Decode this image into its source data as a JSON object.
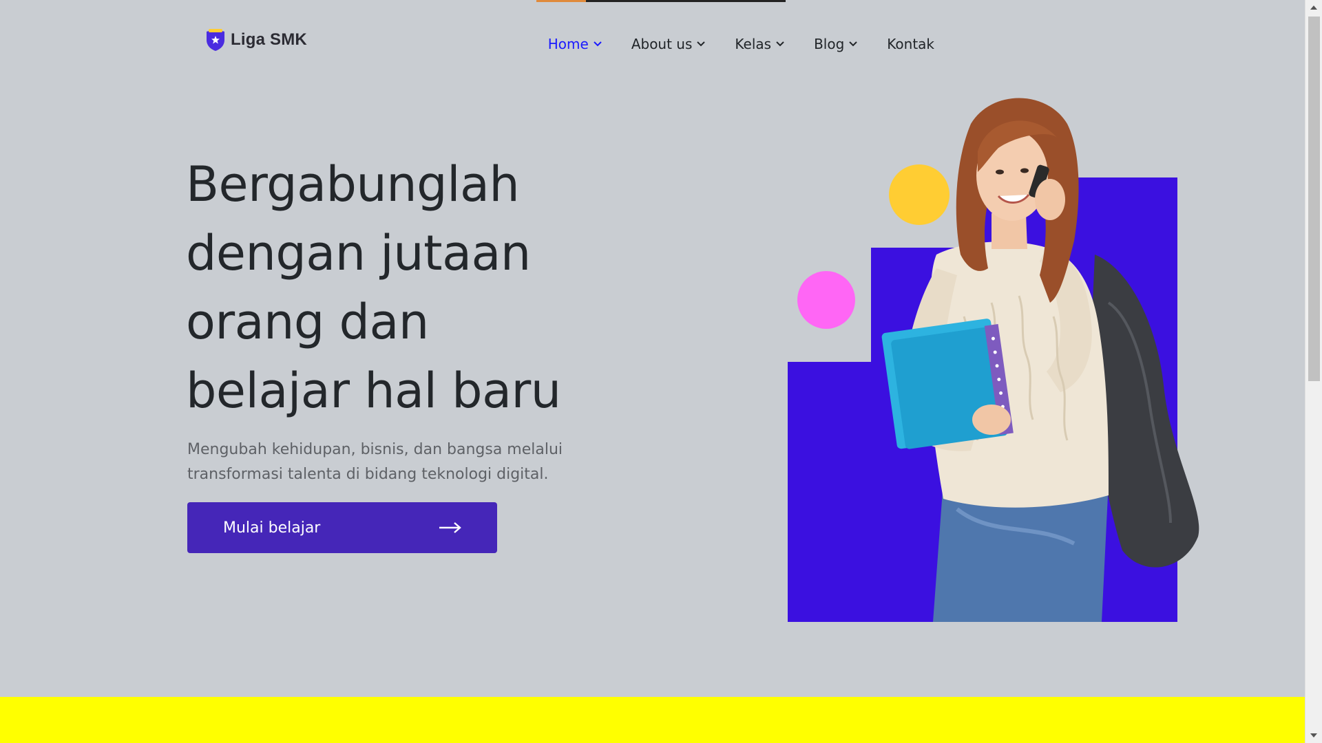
{
  "brand": {
    "name": "Liga SMK",
    "logo_icon": "shield-star-icon"
  },
  "nav": {
    "items": [
      {
        "label": "Home",
        "active": true,
        "has_dropdown": true
      },
      {
        "label": "About us",
        "active": false,
        "has_dropdown": true
      },
      {
        "label": "Kelas",
        "active": false,
        "has_dropdown": true
      },
      {
        "label": "Blog",
        "active": false,
        "has_dropdown": true
      },
      {
        "label": "Kontak",
        "active": false,
        "has_dropdown": false
      }
    ]
  },
  "hero": {
    "title_lines": [
      "Bergabunglah",
      "dengan jutaan",
      "orang dan",
      "belajar hal baru"
    ],
    "subtitle_lines": [
      "Mengubah kehidupan, bisnis, dan bangsa melalui",
      "transformasi talenta di bidang teknologi digital."
    ],
    "cta_label": "Mulai belajar",
    "cta_icon": "arrow-right-icon"
  },
  "colors": {
    "background": "#c9cdd2",
    "accent": "#4526b8",
    "nav_active": "#1a1aff",
    "illustration_bg": "#3b10e0",
    "circle_yellow": "#ffcd33",
    "circle_pink": "#ff66f5",
    "band": "#ffff00"
  }
}
